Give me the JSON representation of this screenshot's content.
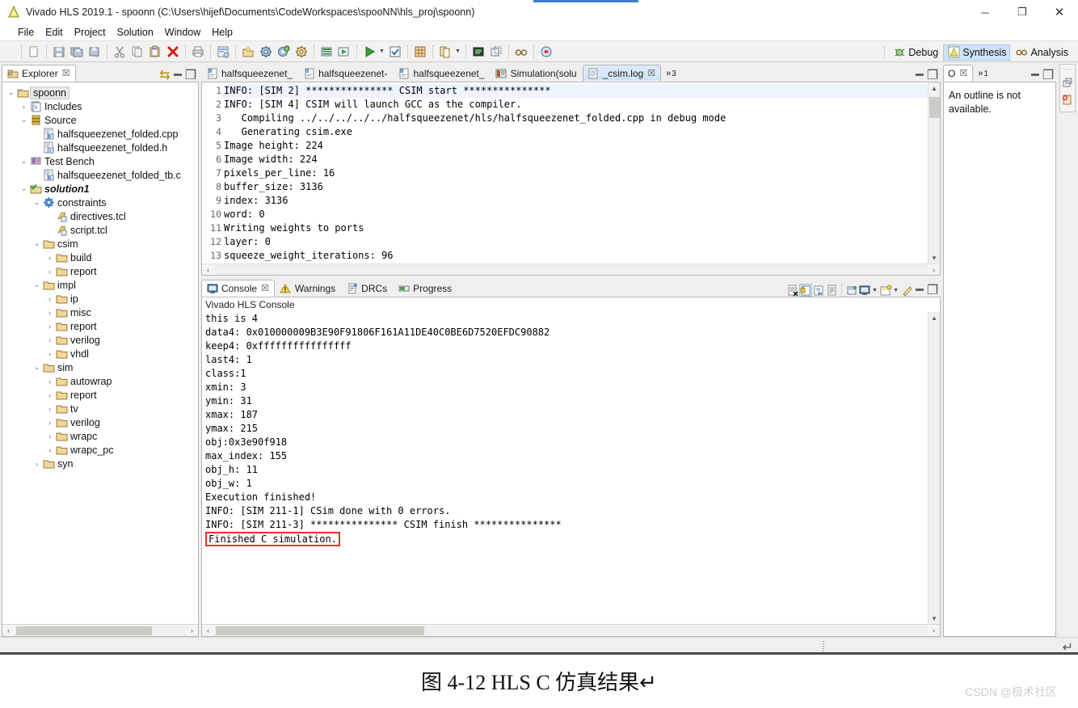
{
  "window": {
    "title": "Vivado HLS 2019.1 - spoonn (C:\\Users\\hijef\\Documents\\CodeWorkspaces\\spooNN\\hls_proj\\spoonn)",
    "app_icon": "vivado-icon",
    "minimize": "─",
    "maximize": "❐",
    "close": "✕"
  },
  "menubar": [
    {
      "label": "File"
    },
    {
      "label": "Edit"
    },
    {
      "label": "Project"
    },
    {
      "label": "Solution"
    },
    {
      "label": "Window"
    },
    {
      "label": "Help"
    }
  ],
  "toolbar": {
    "icons": [
      "new-file-icon",
      "save-icon",
      "save-all-icon",
      "save-as-icon",
      "cut-icon",
      "copy-icon",
      "paste-icon",
      "delete-icon",
      "print-icon",
      "project-settings-icon",
      "new-solution-icon",
      "solution-settings-icon",
      "run-c-simulation-icon",
      "c-synthesis-icon",
      "export-rtl-icon",
      "run-icon",
      "run-dropdown-icon",
      "check-icon",
      "grid-icon",
      "copy-solution-icon",
      "copy-solution-dropdown-icon",
      "compare-reports-icon",
      "open-report-icon",
      "analysis-icon",
      "bug-icon"
    ],
    "perspectives": [
      {
        "label": "Debug",
        "icon": "debug-icon",
        "active": false
      },
      {
        "label": "Synthesis",
        "icon": "synthesis-icon",
        "active": true
      },
      {
        "label": "Analysis",
        "icon": "analysis-glasses-icon",
        "active": false
      }
    ]
  },
  "explorer": {
    "tab_label": "Explorer",
    "tab_icon": "explorer-icon",
    "close_glyph": "☒",
    "view_menu_glyph": "⇆",
    "minimize_glyph": "━",
    "maximize_glyph": "❐",
    "hscroll": {
      "left": "‹",
      "right": "›"
    },
    "tree": [
      {
        "indent": 0,
        "twist": "⌄",
        "icon": "project-folder-icon",
        "label": "spoonn",
        "selected": true,
        "style": ""
      },
      {
        "indent": 1,
        "twist": "›",
        "icon": "includes-icon",
        "label": "Includes",
        "selected": false,
        "style": ""
      },
      {
        "indent": 1,
        "twist": "⌄",
        "icon": "source-icon",
        "label": "Source",
        "selected": false,
        "style": ""
      },
      {
        "indent": 2,
        "twist": "",
        "icon": "cpp-file-icon",
        "label": "halfsqueezenet_folded.cpp",
        "selected": false,
        "style": ""
      },
      {
        "indent": 2,
        "twist": "",
        "icon": "h-file-icon",
        "label": "halfsqueezenet_folded.h",
        "selected": false,
        "style": ""
      },
      {
        "indent": 1,
        "twist": "⌄",
        "icon": "testbench-icon",
        "label": "Test Bench",
        "selected": false,
        "style": ""
      },
      {
        "indent": 2,
        "twist": "",
        "icon": "cpp-file-icon",
        "label": "halfsqueezenet_folded_tb.c",
        "selected": false,
        "style": ""
      },
      {
        "indent": 1,
        "twist": "⌄",
        "icon": "solution-icon",
        "label": "solution1",
        "selected": false,
        "style": "bolditalic"
      },
      {
        "indent": 2,
        "twist": "⌄",
        "icon": "constraints-icon",
        "label": "constraints",
        "selected": false,
        "style": ""
      },
      {
        "indent": 3,
        "twist": "",
        "icon": "tcl-file-icon",
        "label": "directives.tcl",
        "selected": false,
        "style": ""
      },
      {
        "indent": 3,
        "twist": "",
        "icon": "tcl-file-icon",
        "label": "script.tcl",
        "selected": false,
        "style": ""
      },
      {
        "indent": 2,
        "twist": "⌄",
        "icon": "folder-icon",
        "label": "csim",
        "selected": false,
        "style": ""
      },
      {
        "indent": 3,
        "twist": "›",
        "icon": "folder-icon",
        "label": "build",
        "selected": false,
        "style": ""
      },
      {
        "indent": 3,
        "twist": "›",
        "icon": "folder-icon",
        "label": "report",
        "selected": false,
        "style": ""
      },
      {
        "indent": 2,
        "twist": "⌄",
        "icon": "folder-icon",
        "label": "impl",
        "selected": false,
        "style": ""
      },
      {
        "indent": 3,
        "twist": "›",
        "icon": "folder-icon",
        "label": "ip",
        "selected": false,
        "style": ""
      },
      {
        "indent": 3,
        "twist": "›",
        "icon": "folder-icon",
        "label": "misc",
        "selected": false,
        "style": ""
      },
      {
        "indent": 3,
        "twist": "›",
        "icon": "folder-icon",
        "label": "report",
        "selected": false,
        "style": ""
      },
      {
        "indent": 3,
        "twist": "›",
        "icon": "folder-icon",
        "label": "verilog",
        "selected": false,
        "style": ""
      },
      {
        "indent": 3,
        "twist": "›",
        "icon": "folder-icon",
        "label": "vhdl",
        "selected": false,
        "style": ""
      },
      {
        "indent": 2,
        "twist": "⌄",
        "icon": "folder-icon",
        "label": "sim",
        "selected": false,
        "style": ""
      },
      {
        "indent": 3,
        "twist": "›",
        "icon": "folder-icon",
        "label": "autowrap",
        "selected": false,
        "style": ""
      },
      {
        "indent": 3,
        "twist": "›",
        "icon": "folder-icon",
        "label": "report",
        "selected": false,
        "style": ""
      },
      {
        "indent": 3,
        "twist": "›",
        "icon": "folder-icon",
        "label": "tv",
        "selected": false,
        "style": ""
      },
      {
        "indent": 3,
        "twist": "›",
        "icon": "folder-icon",
        "label": "verilog",
        "selected": false,
        "style": ""
      },
      {
        "indent": 3,
        "twist": "›",
        "icon": "folder-icon",
        "label": "wrapc",
        "selected": false,
        "style": ""
      },
      {
        "indent": 3,
        "twist": "›",
        "icon": "folder-icon",
        "label": "wrapc_pc",
        "selected": false,
        "style": ""
      },
      {
        "indent": 2,
        "twist": "›",
        "icon": "folder-icon",
        "label": "syn",
        "selected": false,
        "style": ""
      }
    ]
  },
  "editor": {
    "tabs": [
      {
        "label": "halfsqueezenet_",
        "icon": "c-file-icon",
        "active": false,
        "closeable": false
      },
      {
        "label": "halfsqueezenet-",
        "icon": "h-file-icon",
        "active": false,
        "closeable": false
      },
      {
        "label": "halfsqueezenet_",
        "icon": "c-file-icon",
        "active": false,
        "closeable": false
      },
      {
        "label": "Simulation(solu",
        "icon": "simulation-icon",
        "active": false,
        "closeable": false
      },
      {
        "label": "_csim.log",
        "icon": "log-file-icon",
        "active": true,
        "closeable": true
      }
    ],
    "overflow_label": "»",
    "overflow_count": "3",
    "close_glyph": "☒",
    "minimize_glyph": "━",
    "maximize_glyph": "❐",
    "lines": [
      {
        "n": "1",
        "text": "INFO: [SIM 2] *************** CSIM start ***************",
        "current": true
      },
      {
        "n": "2",
        "text": "INFO: [SIM 4] CSIM will launch GCC as the compiler.",
        "current": false
      },
      {
        "n": "3",
        "text": "   Compiling ../../../../../halfsqueezenet/hls/halfsqueezenet_folded.cpp in debug mode",
        "current": false
      },
      {
        "n": "4",
        "text": "   Generating csim.exe",
        "current": false
      },
      {
        "n": "5",
        "text": "Image height: 224",
        "current": false
      },
      {
        "n": "6",
        "text": "Image width: 224",
        "current": false
      },
      {
        "n": "7",
        "text": "pixels_per_line: 16",
        "current": false
      },
      {
        "n": "8",
        "text": "buffer_size: 3136",
        "current": false
      },
      {
        "n": "9",
        "text": "index: 3136",
        "current": false
      },
      {
        "n": "10",
        "text": "word: 0",
        "current": false
      },
      {
        "n": "11",
        "text": "Writing weights to ports",
        "current": false
      },
      {
        "n": "12",
        "text": "layer: 0",
        "current": false
      },
      {
        "n": "13",
        "text": "squeeze_weight_iterations: 96",
        "current": false
      }
    ],
    "scroll": {
      "up": "▴",
      "down": "▾",
      "left": "‹",
      "right": "›"
    }
  },
  "console": {
    "tabs": [
      {
        "label": "Console",
        "icon": "console-icon",
        "active": true,
        "closeable": true
      },
      {
        "label": "Warnings",
        "icon": "warning-icon",
        "active": false,
        "closeable": false
      },
      {
        "label": "DRCs",
        "icon": "drc-icon",
        "active": false,
        "closeable": false
      },
      {
        "label": "Progress",
        "icon": "progress-icon",
        "active": false,
        "closeable": false
      }
    ],
    "close_glyph": "☒",
    "toolbar_icons": [
      "clear-console-icon",
      "scroll-lock-icon",
      "show-console-on-output-icon",
      "pin-console-icon",
      "open-console-icon",
      "display-selected-console-icon",
      "display-console-dropdown-icon",
      "new-console-view-icon",
      "new-console-dropdown-icon",
      "pencil-icon"
    ],
    "minimize_glyph": "━",
    "maximize_glyph": "❐",
    "title": "Vivado HLS Console",
    "lines": [
      {
        "text": "this is 4",
        "highlight": false
      },
      {
        "text": "data4: 0x010000009B3E90F91806F161A11DE40C0BE6D7520EFDC90882",
        "highlight": false
      },
      {
        "text": "keep4: 0xffffffffffffffff",
        "highlight": false
      },
      {
        "text": "last4: 1",
        "highlight": false
      },
      {
        "text": "class:1",
        "highlight": false
      },
      {
        "text": "xmin: 3",
        "highlight": false
      },
      {
        "text": "ymin: 31",
        "highlight": false
      },
      {
        "text": "xmax: 187",
        "highlight": false
      },
      {
        "text": "ymax: 215",
        "highlight": false
      },
      {
        "text": "obj:0x3e90f918",
        "highlight": false
      },
      {
        "text": "max_index: 155",
        "highlight": false
      },
      {
        "text": "obj_h: 11",
        "highlight": false
      },
      {
        "text": "obj_w: 1",
        "highlight": false
      },
      {
        "text": "Execution finished!",
        "highlight": false
      },
      {
        "text": "INFO: [SIM 211-1] CSim done with 0 errors.",
        "highlight": false
      },
      {
        "text": "INFO: [SIM 211-3] *************** CSIM finish ***************",
        "highlight": false
      },
      {
        "text": "Finished C simulation.",
        "highlight": true
      }
    ],
    "highlight_color": "#e8342a",
    "scroll": {
      "up": "▴",
      "down": "▾",
      "left": "‹",
      "right": "›"
    }
  },
  "outline": {
    "tab_label": "O",
    "close_glyph": "☒",
    "overflow_label": "»",
    "overflow_count": "1",
    "minimize_glyph": "━",
    "maximize_glyph": "❐",
    "message": "An outline is not available."
  },
  "fastview": {
    "dots": "····",
    "icons": [
      "restore-view-icon",
      "error-log-icon"
    ]
  },
  "statusbar": {
    "resize_grip": "grip-icon",
    "return_arrow": "↵"
  },
  "caption": {
    "text": "图 4-12 HLS C 仿真结果↵",
    "watermark": "CSDN @极术社区"
  }
}
